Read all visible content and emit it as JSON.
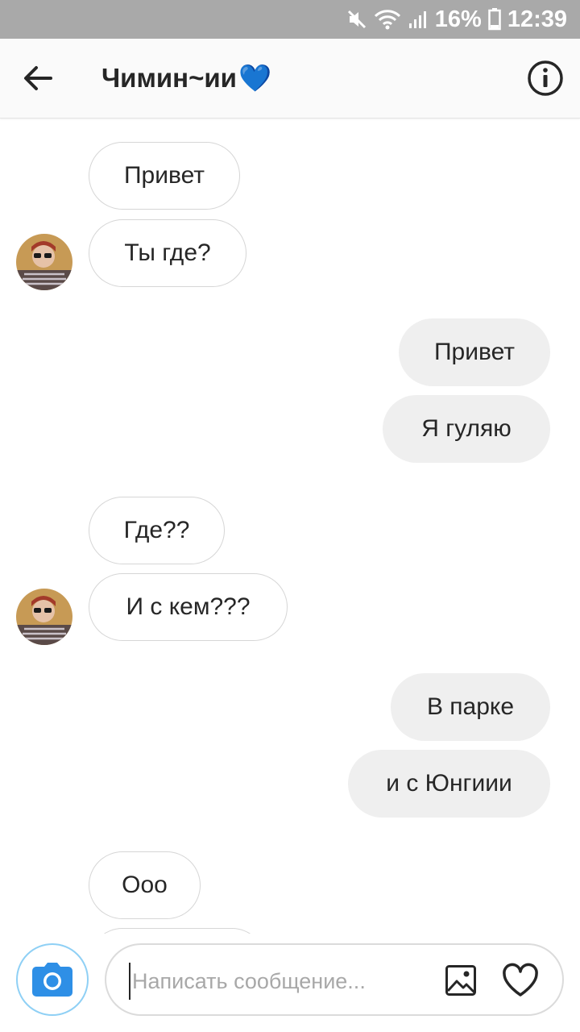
{
  "status_bar": {
    "battery": "16%",
    "time": "12:39",
    "icons": [
      "mute-icon",
      "wifi-icon",
      "signal-icon",
      "battery-icon"
    ]
  },
  "header": {
    "title": "Чимин~ии",
    "title_emoji": "💙",
    "back_icon": "arrow-left-icon",
    "info_icon": "info-icon"
  },
  "messages": [
    {
      "side": "incoming",
      "text": "Привет"
    },
    {
      "side": "incoming",
      "text": "Ты где?"
    },
    {
      "side": "outgoing",
      "text": "Привет"
    },
    {
      "side": "outgoing",
      "text": "Я гуляю"
    },
    {
      "side": "incoming",
      "text": "Где??"
    },
    {
      "side": "incoming",
      "text": "И с кем???"
    },
    {
      "side": "outgoing",
      "text": "В парке"
    },
    {
      "side": "outgoing",
      "text": "и с Юнгиии"
    },
    {
      "side": "incoming",
      "text": "Ооо"
    }
  ],
  "composer": {
    "placeholder": "Написать сообщение...",
    "camera_icon": "camera-icon",
    "gallery_icon": "gallery-icon",
    "heart_icon": "heart-icon"
  },
  "colors": {
    "status_bar": "#a9a9a9",
    "incoming_border": "#d6d6d6",
    "outgoing_bg": "#efefef",
    "camera_blue": "#2e8fe6"
  }
}
